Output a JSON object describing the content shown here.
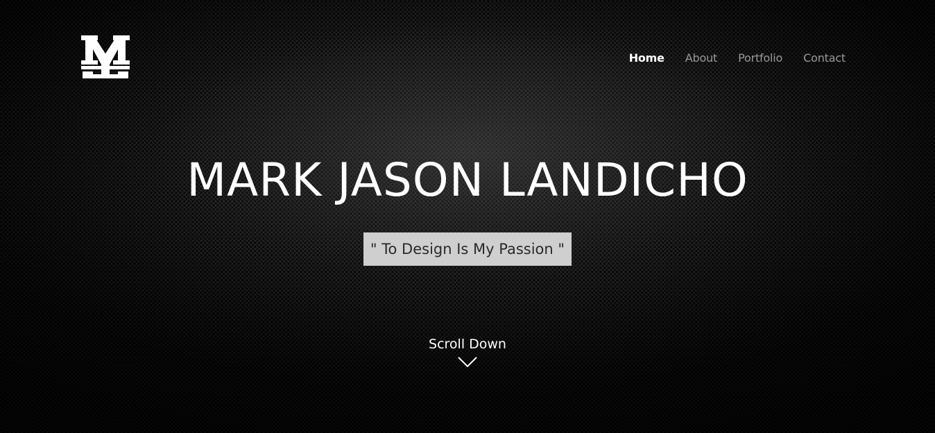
{
  "header": {
    "logo_icon": "monogram-logo-icon",
    "nav": [
      {
        "label": "Home",
        "active": true
      },
      {
        "label": "About",
        "active": false
      },
      {
        "label": "Portfolio",
        "active": false
      },
      {
        "label": "Contact",
        "active": false
      }
    ]
  },
  "hero": {
    "title": "MARK JASON LANDICHO",
    "tagline": "\" To Design Is My Passion \"",
    "scroll_label": "Scroll Down",
    "scroll_icon": "chevron-down-icon"
  },
  "colors": {
    "background": "#161616",
    "text": "#ffffff",
    "nav_inactive": "#9a9a9a",
    "tagline_bg": "#cfcfcf",
    "tagline_text": "#2a2a2a"
  }
}
